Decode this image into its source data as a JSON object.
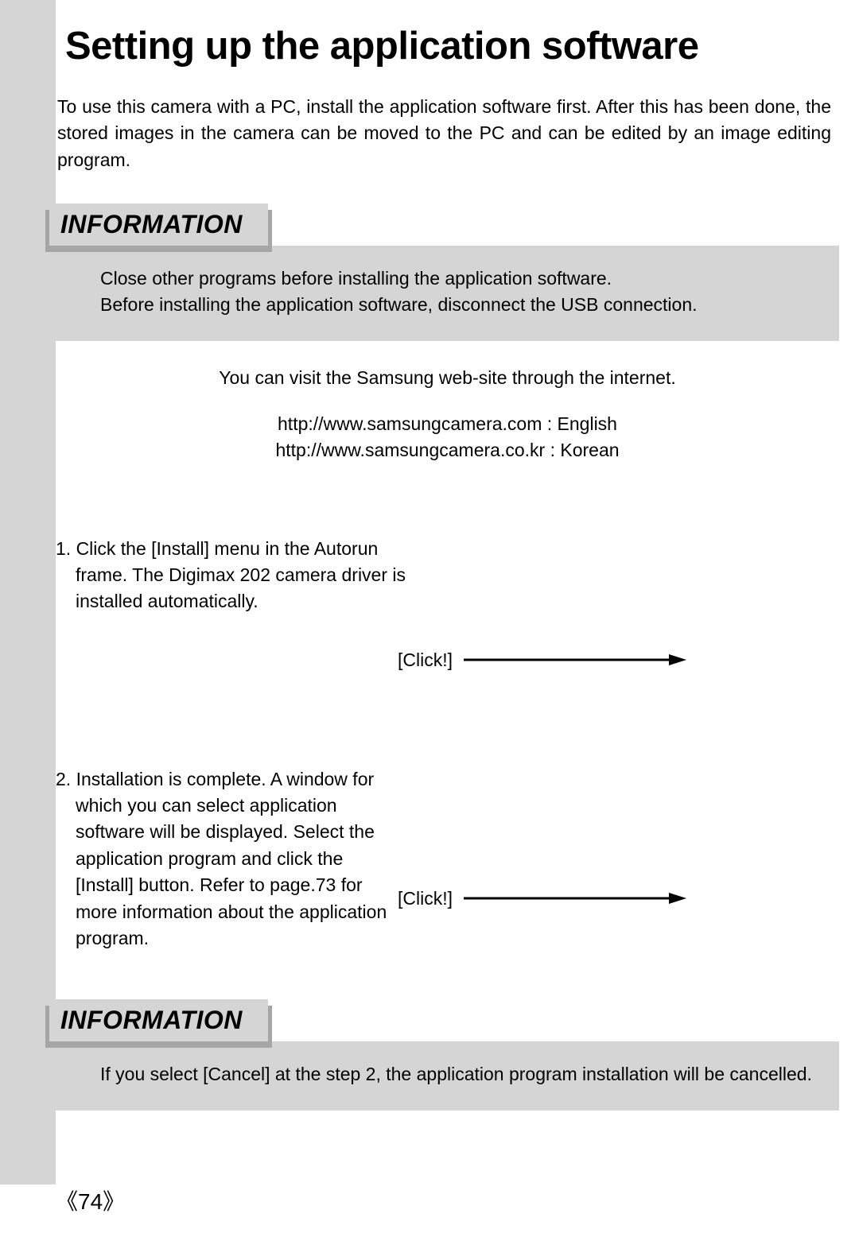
{
  "title": "Setting up the application software",
  "intro": "To use this camera with a PC, install the application software first. After this has been done, the stored images in the camera can be moved to the PC and can be edited by an image editing program.",
  "info1": {
    "heading": "INFORMATION",
    "line1": "Close other programs before installing the application software.",
    "line2": "Before installing the application software, disconnect the USB connection."
  },
  "web": {
    "lead": "You can visit the Samsung web-site through the internet.",
    "url1": "http://www.samsungcamera.com : English",
    "url2": "http://www.samsungcamera.co.kr : Korean"
  },
  "step1": {
    "text": "1. Click the [Install] menu in the Autorun frame. The Digimax 202 camera driver is installed automatically.",
    "click": "[Click!]"
  },
  "step2": {
    "text": "2. Installation is complete. A window for which you can select application software will be displayed. Select the application program and click the [Install] button. Refer to page.73 for more information about the application program.",
    "click": "[Click!]"
  },
  "info2": {
    "heading": "INFORMATION",
    "body": "If you select [Cancel] at the step 2, the application program installation will be cancelled."
  },
  "page_number": "74"
}
